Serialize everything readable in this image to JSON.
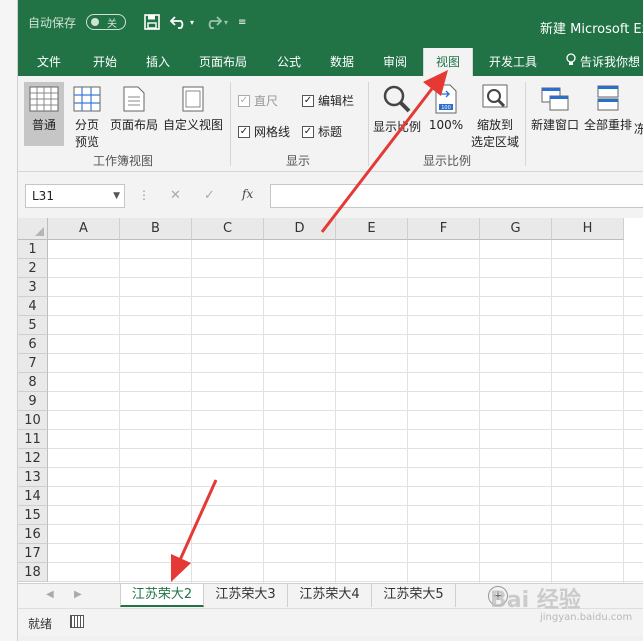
{
  "qat": {
    "autosave_label": "自动保存",
    "autosave_state": "关",
    "save_icon": "save-icon",
    "undo_icon": "undo-icon",
    "redo_icon": "redo-icon",
    "customize_icon": "customize-icon"
  },
  "window": {
    "title": "新建 Microsoft Ex"
  },
  "tabs": [
    {
      "label": "文件"
    },
    {
      "label": "开始"
    },
    {
      "label": "插入"
    },
    {
      "label": "页面布局"
    },
    {
      "label": "公式"
    },
    {
      "label": "数据"
    },
    {
      "label": "审阅"
    },
    {
      "label": "视图"
    },
    {
      "label": "开发工具"
    }
  ],
  "active_tab": "视图",
  "tellme": {
    "label": "告诉我你想"
  },
  "ribbon": {
    "workbook_views": {
      "label": "工作簿视图",
      "normal": "普通",
      "page_break_1": "分页",
      "page_break_2": "预览",
      "page_layout": "页面布局",
      "custom_views": "自定义视图"
    },
    "show": {
      "label": "显示",
      "ruler": "直尺",
      "formula_bar": "编辑栏",
      "gridlines": "网格线",
      "headings": "标题"
    },
    "zoom": {
      "label": "显示比例",
      "zoom": "显示比例",
      "zoom100": "100%",
      "zoom_sel_1": "缩放到",
      "zoom_sel_2": "选定区域"
    },
    "window": {
      "new_window": "新建窗口",
      "arrange_all": "全部重排",
      "freeze": "冻"
    }
  },
  "formula_bar": {
    "name_box": "L31",
    "fx": "fx",
    "value": ""
  },
  "columns": [
    "A",
    "B",
    "C",
    "D",
    "E",
    "F",
    "G",
    "H"
  ],
  "rows": [
    "1",
    "2",
    "3",
    "4",
    "5",
    "6",
    "7",
    "8",
    "9",
    "10",
    "11",
    "12",
    "13",
    "14",
    "15",
    "16",
    "17",
    "18"
  ],
  "sheets": [
    {
      "label": "江苏荣大2",
      "active": true
    },
    {
      "label": "江苏荣大3",
      "active": false
    },
    {
      "label": "江苏荣大4",
      "active": false
    },
    {
      "label": "江苏荣大5",
      "active": false
    }
  ],
  "status": {
    "text": "就绪"
  },
  "watermark": {
    "main": "Bai 经验",
    "sub": "jingyan.baidu.com"
  },
  "colors": {
    "accent": "#217346",
    "arrow": "#e53935"
  }
}
